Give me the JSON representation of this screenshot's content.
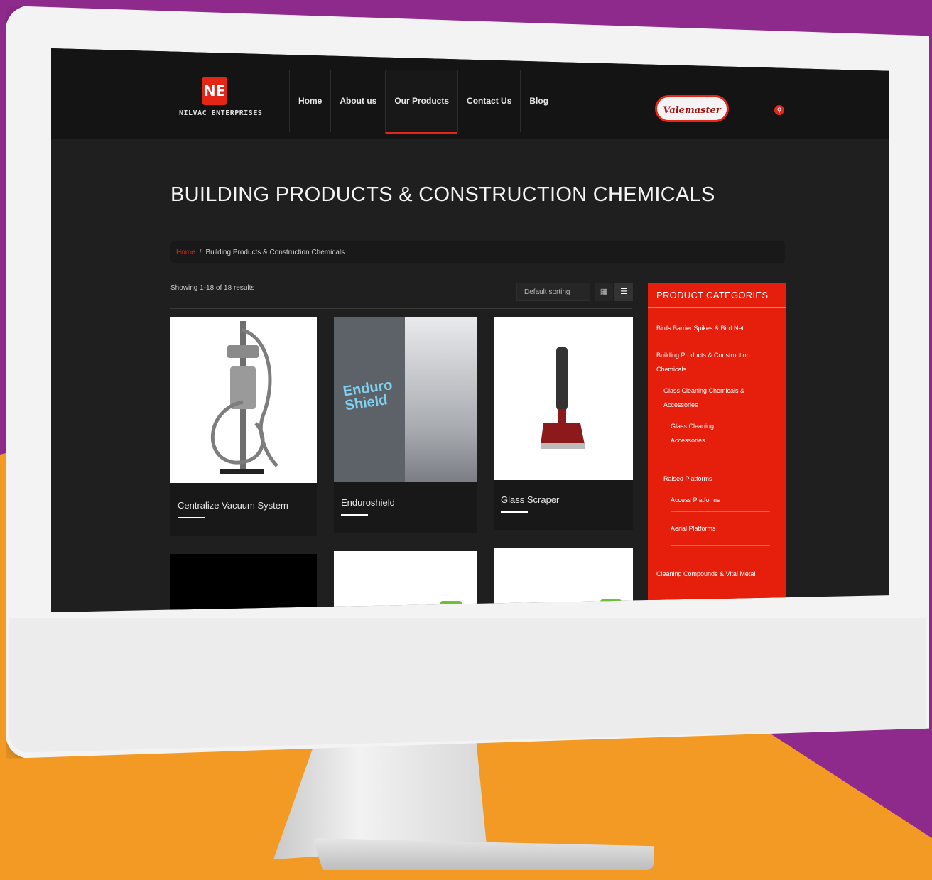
{
  "site": {
    "logo_mark": "NE",
    "logo_text": "NILVAC ENTERPRISES",
    "nav": [
      "Home",
      "About us",
      "Our Products",
      "Contact Us",
      "Blog"
    ],
    "brand_badge": "Valemaster"
  },
  "page": {
    "title": "BUILDING PRODUCTS & CONSTRUCTION CHEMICALS",
    "breadcrumb_home": "Home",
    "breadcrumb_sep": "/",
    "breadcrumb_current": "Building Products & Construction Chemicals",
    "results": "Showing 1-18 of 18 results",
    "sort": "Default sorting"
  },
  "products": [
    {
      "title": "Centralize Vacuum System"
    },
    {
      "title": "Enduroshield",
      "image_text": "Enduro Shield"
    },
    {
      "title": "Glass Scraper"
    }
  ],
  "sidebar": {
    "title": "PRODUCT CATEGORIES",
    "categories": [
      "Birds Barrier Spikes & Bird Net",
      "Building Products & Construction Chemicals",
      "Glass Cleaning Chemicals & Accessories",
      "Glass Cleaning Accessories",
      "Raised Platforms",
      "Access Platforms",
      "Aerial Platforms",
      "Cleaning Compounds & Vital Metal"
    ]
  },
  "colors": {
    "accent": "#e52515",
    "background": "#1f1f1f",
    "header": "#141414",
    "sidebar": "#e61e0c"
  }
}
